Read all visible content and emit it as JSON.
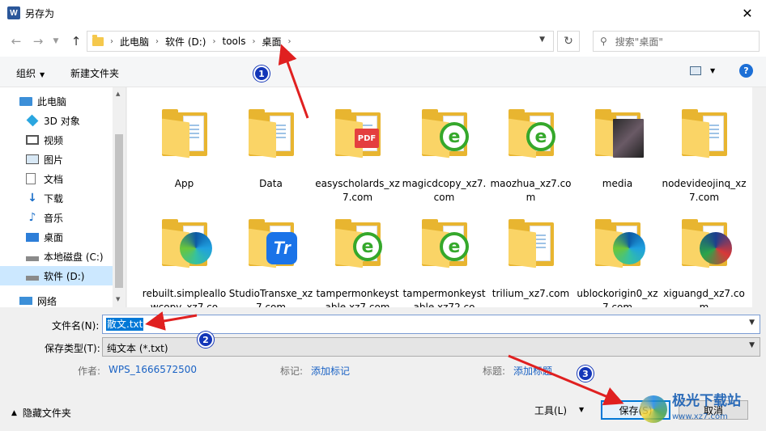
{
  "window": {
    "title": "另存为",
    "app_icon_letter": "W"
  },
  "nav": {
    "breadcrumbs": [
      "此电脑",
      "软件 (D:)",
      "tools",
      "桌面"
    ],
    "search_placeholder": "搜索\"桌面\""
  },
  "toolbar": {
    "organize": "组织",
    "new_folder": "新建文件夹",
    "help": "?"
  },
  "sidebar": {
    "items": [
      {
        "label": "此电脑",
        "icon": "computer-icon"
      },
      {
        "label": "3D 对象",
        "icon": "cube-3d-icon"
      },
      {
        "label": "视频",
        "icon": "video-icon"
      },
      {
        "label": "图片",
        "icon": "picture-icon"
      },
      {
        "label": "文档",
        "icon": "document-icon"
      },
      {
        "label": "下载",
        "icon": "download-icon"
      },
      {
        "label": "音乐",
        "icon": "music-icon"
      },
      {
        "label": "桌面",
        "icon": "desktop-icon"
      },
      {
        "label": "本地磁盘 (C:)",
        "icon": "drive-icon"
      },
      {
        "label": "软件 (D:)",
        "icon": "drive-icon",
        "selected": true
      },
      {
        "label": "网络",
        "icon": "network-icon"
      }
    ]
  },
  "files": [
    {
      "name": "App",
      "badge": "none"
    },
    {
      "name": "Data",
      "badge": "none"
    },
    {
      "name": "easyscholards_xz7.com",
      "badge": "pdf"
    },
    {
      "name": "magicdcopy_xz7.com",
      "badge": "ie"
    },
    {
      "name": "maozhua_xz7.com",
      "badge": "ie"
    },
    {
      "name": "media",
      "badge": "photo"
    },
    {
      "name": "nodevideojinq_xz7.com",
      "badge": "none"
    },
    {
      "name": "rebuilt.simpleallowcopy_xz7.co",
      "badge": "edge"
    },
    {
      "name": "StudioTransxe_xz7.com",
      "badge": "tr"
    },
    {
      "name": "tampermonkeystable xz7.com",
      "badge": "ie"
    },
    {
      "name": "tampermonkeystable xz72.co",
      "badge": "ie"
    },
    {
      "name": "trilium_xz7.com",
      "badge": "none"
    },
    {
      "name": "ublockorigin0_xz7.com",
      "badge": "edge"
    },
    {
      "name": "xiguangd_xz7.com",
      "badge": "xg"
    }
  ],
  "form": {
    "filename_label": "文件名(N):",
    "filename_value": "散文.txt",
    "filetype_label": "保存类型(T):",
    "filetype_value": "纯文本 (*.txt)"
  },
  "meta": {
    "author_label": "作者:",
    "author_value": "WPS_1666572500",
    "tags_label": "标记:",
    "tags_value": "添加标记",
    "title_label": "标题:",
    "title_value": "添加标题"
  },
  "footer": {
    "hide_folders": "隐藏文件夹",
    "tools": "工具(L)",
    "save": "保存(S)",
    "cancel": "取消"
  },
  "annotations": {
    "markers": [
      "1",
      "2",
      "3"
    ],
    "arrow_color": "#e02020",
    "marker_color": "#1336b8"
  },
  "watermark": {
    "title": "极光下载站",
    "url": "www.xz7.com"
  }
}
